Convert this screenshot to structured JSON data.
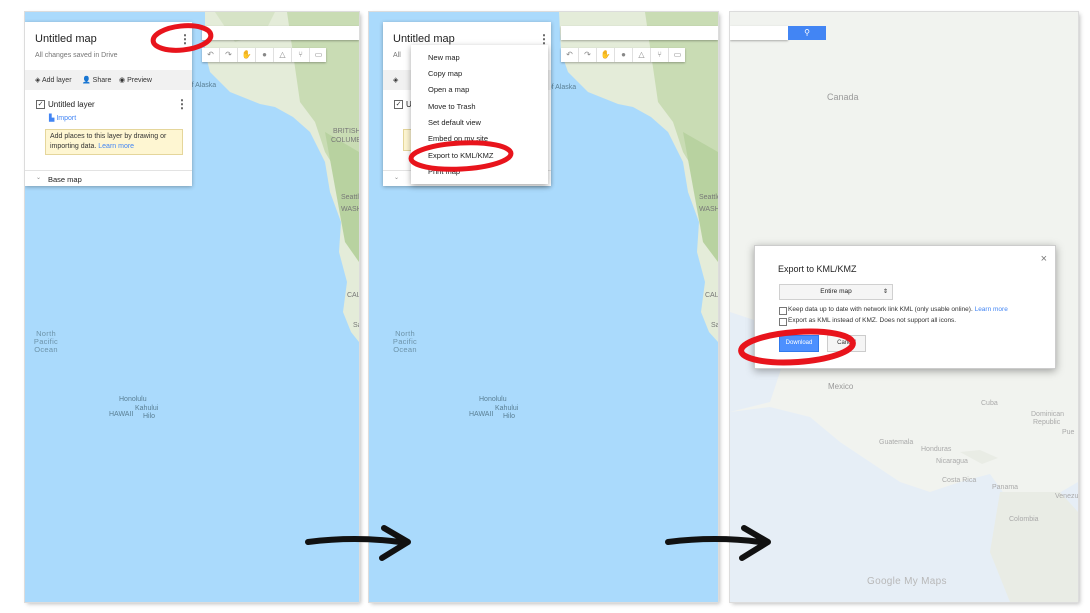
{
  "panel1": {
    "map_title": "Untitled map",
    "save_status": "All changes saved in Drive",
    "add_layer": "Add layer",
    "share": "Share",
    "preview": "Preview",
    "layer_name": "Untitled layer",
    "import": "Import",
    "hint_text": "Add places to this layer by drawing or importing data.",
    "learn_more": "Learn more",
    "base_map": "Base map",
    "kebab": "⋮",
    "labels": {
      "gulf": "Gulf of Alaska",
      "british": "BRITISH",
      "columbia": "COLUMBI",
      "seattle": "Seattle",
      "wash": "WASH",
      "cal": "CAL",
      "sa": "Sa",
      "ocean1": "North",
      "ocean2": "Pacific",
      "ocean3": "Ocean",
      "honolulu": "Honolulu",
      "hawaii": "HAWAII",
      "kahului": "Kahului",
      "hilo": "Hilo"
    }
  },
  "panel2": {
    "map_title": "Untitled map",
    "save_status": "All",
    "layer_initial": "U",
    "kebab": "⋮",
    "menu_items": [
      "New map",
      "Copy map",
      "Open a map",
      "Move to Trash",
      "Set default view",
      "Embed on my site",
      "Export to KML/KMZ",
      "Print map"
    ],
    "labels": {
      "gulf": "Gulf of Alaska",
      "seattle": "Seattle",
      "wash": "WASH",
      "cal": "CAL",
      "sa": "Sa",
      "ocean1": "North",
      "ocean2": "Pacific",
      "ocean3": "Ocean",
      "honolulu": "Honolulu",
      "hawaii": "HAWAII",
      "kahului": "Kahului",
      "hilo": "Hilo"
    }
  },
  "panel3": {
    "dialog_title": "Export to KML/KMZ",
    "close": "×",
    "select_value": "Entire map",
    "option1": "Keep data up to date with network link KML (only usable online).",
    "option1_link": "Learn more",
    "option2": "Export as KML instead of KMZ. Does not support all icons.",
    "download": "Download",
    "cancel": "Cancel",
    "brand": "Google My Maps",
    "labels": {
      "canada": "Canada",
      "mexico": "Mexico",
      "cuba": "Cuba",
      "dominican": "Dominican",
      "republic": "Republic",
      "guatemala": "Guatemala",
      "honduras": "Honduras",
      "nicaragua": "Nicaragua",
      "costarica": "Costa Rica",
      "panama": "Panama",
      "venezuela": "Venezu",
      "colombia": "Colombia",
      "puerto": "Pue"
    }
  },
  "colors": {
    "ocean": "#aadafc",
    "land": "#e8eee1",
    "annotation_red": "#e8141c",
    "accent_blue": "#4285f4"
  }
}
